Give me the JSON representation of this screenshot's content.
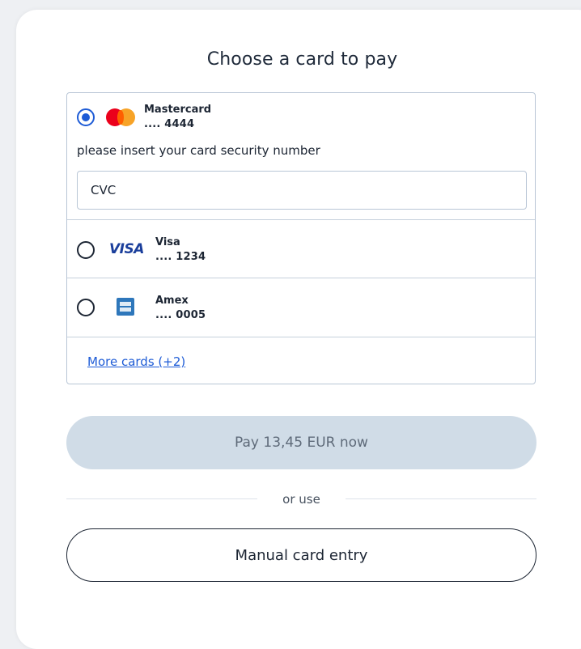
{
  "header": {
    "title": "Choose a card to pay"
  },
  "cards": [
    {
      "brand": "Mastercard",
      "masked_number": ".... 4444",
      "selected": true,
      "logo_icon": "mastercard-logo-icon"
    },
    {
      "brand": "Visa",
      "masked_number": ".... 1234",
      "selected": false,
      "logo_icon": "visa-logo-icon",
      "logo_text": "VISA"
    },
    {
      "brand": "Amex",
      "masked_number": ".... 0005",
      "selected": false,
      "logo_icon": "amex-logo-icon"
    }
  ],
  "security": {
    "hint": "please insert your card security number",
    "cvc_placeholder": "CVC",
    "cvc_value": ""
  },
  "more_cards_link": "More cards (+2)",
  "actions": {
    "pay_label": "Pay 13,45 EUR now",
    "or_label": "or use",
    "manual_label": "Manual card entry"
  },
  "colors": {
    "accent": "#1d5bd6",
    "pay_button_disabled_bg": "#d0dce7",
    "border": "#b9c6d6",
    "text": "#1c2533"
  }
}
